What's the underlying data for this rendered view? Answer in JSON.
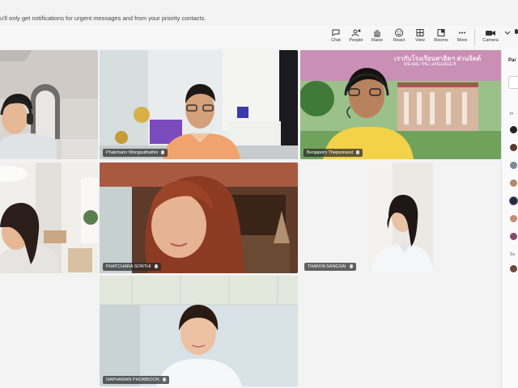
{
  "notification": {
    "text": "u'll only get notifications for urgent messages and from your priority contacts."
  },
  "toolbar": {
    "chat": "Chat",
    "people": "People",
    "raise": "Raise",
    "react": "React",
    "view": "View",
    "rooms": "Rooms",
    "more": "More",
    "camera": "Camera"
  },
  "tiles": {
    "t2": "Phatcharin Wongsuthathin",
    "t3": "Benjaporn Thepsorasut",
    "t5": "PHATCHARA SONTHI",
    "t6": "THANYA SANGSAI",
    "t7": "NAPHAWAN PHOMBOON"
  },
  "banner": {
    "line1": "เรากับโรงเรียนสาธิตฯ ส่วนจิตต์",
    "line2": "WE ARE THE LANGUAGE B"
  },
  "panel": {
    "title": "Par",
    "section1": "In",
    "section2": "Su"
  },
  "colors": {
    "accent": "#5b5fc7",
    "tile_border": "#ffffff"
  }
}
